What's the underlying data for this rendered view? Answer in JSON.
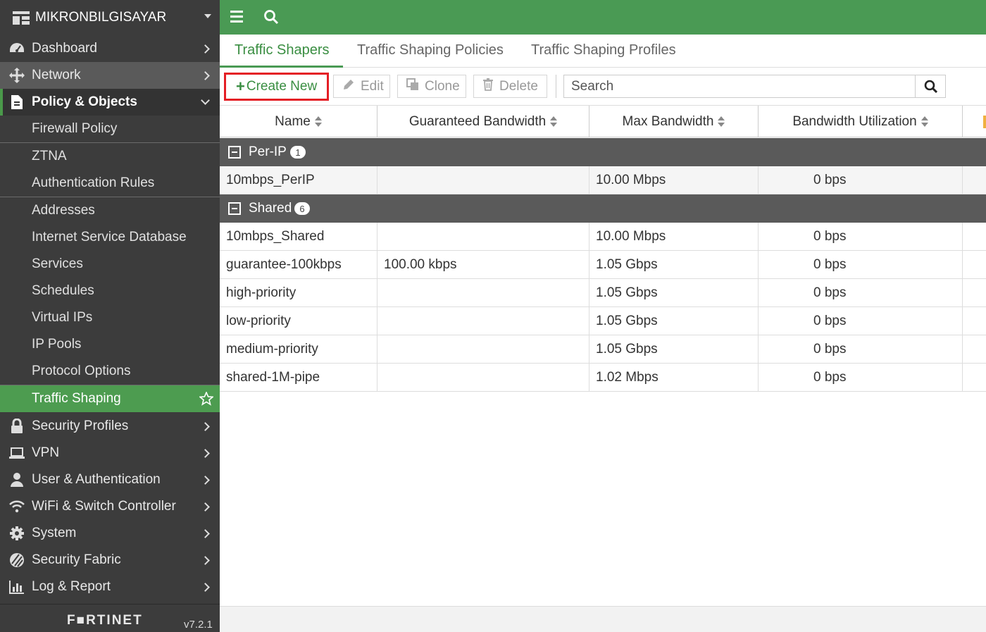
{
  "sidebar": {
    "device_name": "MIKRONBILGISAYAR",
    "items": [
      {
        "label": "Dashboard",
        "icon": "dashboard-icon"
      },
      {
        "label": "Network",
        "icon": "network-icon"
      },
      {
        "label": "Policy & Objects",
        "icon": "policy-icon"
      },
      {
        "label": "Security Profiles",
        "icon": "lock-icon"
      },
      {
        "label": "VPN",
        "icon": "laptop-icon"
      },
      {
        "label": "User & Authentication",
        "icon": "user-icon"
      },
      {
        "label": "WiFi & Switch Controller",
        "icon": "wifi-icon"
      },
      {
        "label": "System",
        "icon": "gear-icon"
      },
      {
        "label": "Security Fabric",
        "icon": "fabric-icon"
      },
      {
        "label": "Log & Report",
        "icon": "chart-icon"
      }
    ],
    "sub_items": [
      "Firewall Policy",
      "ZTNA",
      "Authentication Rules",
      "Addresses",
      "Internet Service Database",
      "Services",
      "Schedules",
      "Virtual IPs",
      "IP Pools",
      "Protocol Options",
      "Traffic Shaping"
    ],
    "logo": "F■RTINET",
    "version": "v7.2.1"
  },
  "tabs": [
    "Traffic Shapers",
    "Traffic Shaping Policies",
    "Traffic Shaping Profiles"
  ],
  "toolbar": {
    "create_new": "Create New",
    "edit": "Edit",
    "clone": "Clone",
    "delete": "Delete",
    "search_placeholder": "Search"
  },
  "table": {
    "columns": [
      "Name",
      "Guaranteed Bandwidth",
      "Max Bandwidth",
      "Bandwidth Utilization"
    ],
    "groups": [
      {
        "label": "Per-IP",
        "count": "1",
        "rows": [
          {
            "name": "10mbps_PerIP",
            "guaranteed": "",
            "max": "10.00 Mbps",
            "util": "0 bps"
          }
        ]
      },
      {
        "label": "Shared",
        "count": "6",
        "rows": [
          {
            "name": "10mbps_Shared",
            "guaranteed": "",
            "max": "10.00 Mbps",
            "util": "0 bps"
          },
          {
            "name": "guarantee-100kbps",
            "guaranteed": "100.00 kbps",
            "max": "1.05 Gbps",
            "util": "0 bps"
          },
          {
            "name": "high-priority",
            "guaranteed": "",
            "max": "1.05 Gbps",
            "util": "0 bps"
          },
          {
            "name": "low-priority",
            "guaranteed": "",
            "max": "1.05 Gbps",
            "util": "0 bps"
          },
          {
            "name": "medium-priority",
            "guaranteed": "",
            "max": "1.05 Gbps",
            "util": "0 bps"
          },
          {
            "name": "shared-1M-pipe",
            "guaranteed": "",
            "max": "1.02 Mbps",
            "util": "0 bps"
          }
        ]
      }
    ]
  },
  "colors": {
    "accent": "#4a9a54",
    "sidebar_bg": "#3c3c3c",
    "highlight_border": "#e41e25"
  }
}
